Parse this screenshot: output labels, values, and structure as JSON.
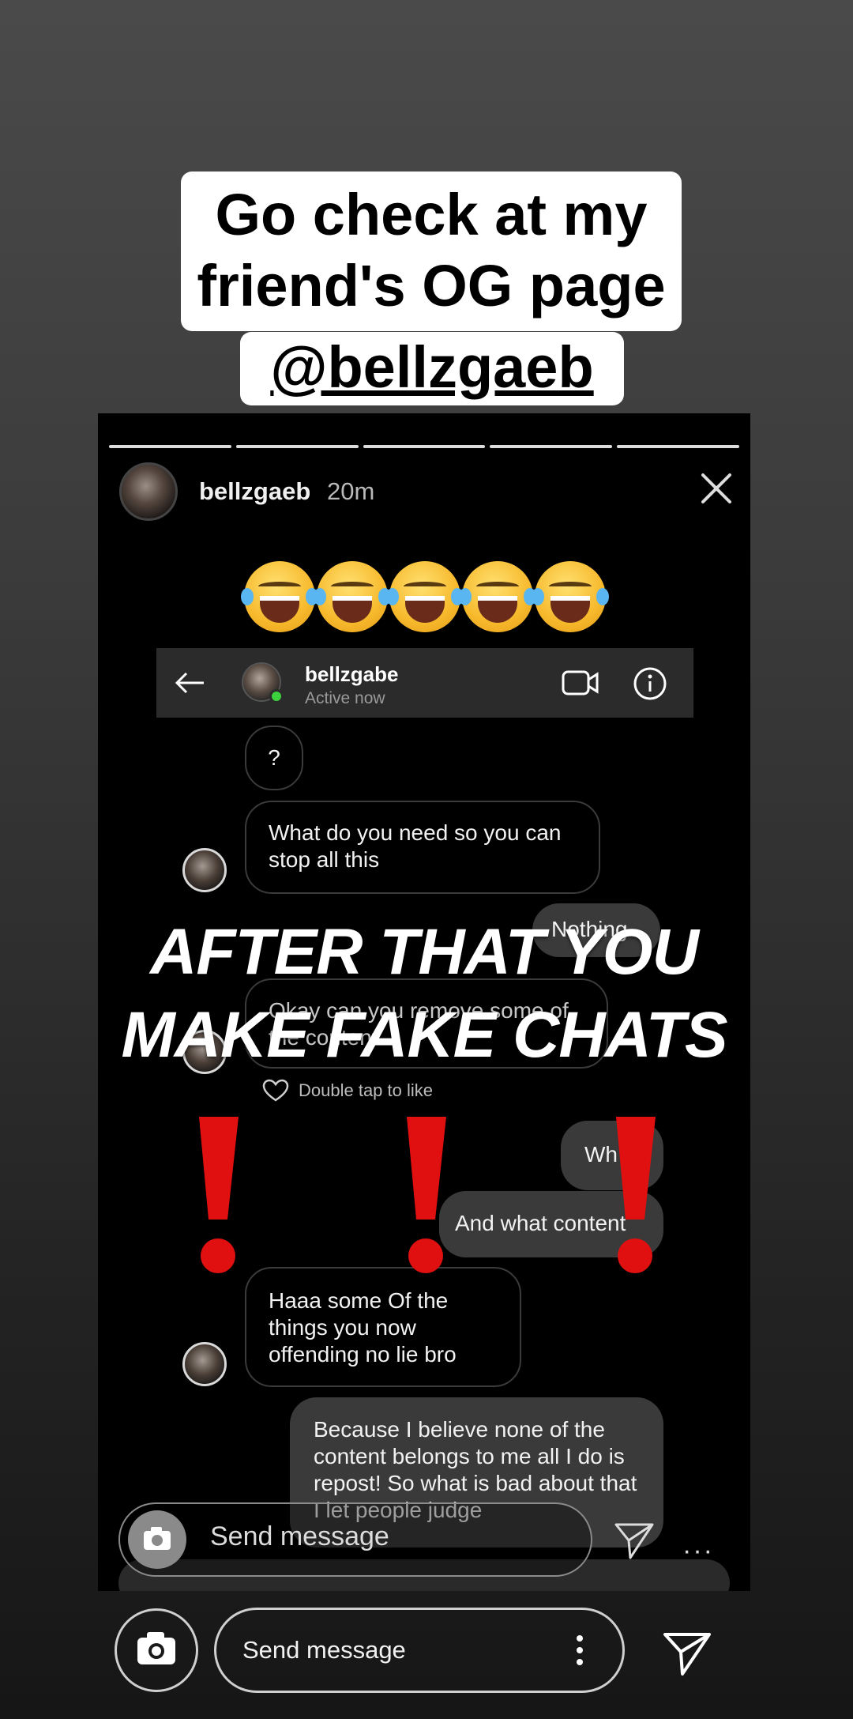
{
  "caption": {
    "line1": "Go check at my",
    "line2": "friend's OG page",
    "handle": "@bellzgaeb"
  },
  "story": {
    "username": "bellzgaeb",
    "time": "20m",
    "emoji_row": "😂😂😂😂😂",
    "dm_header": {
      "name": "bellzgabe",
      "status": "Active now"
    },
    "messages": [
      {
        "dir": "in",
        "text": "?"
      },
      {
        "dir": "in",
        "text": "What do you need so you can stop all this"
      },
      {
        "dir": "out",
        "text": "Nothing"
      },
      {
        "dir": "in",
        "text": "Okay can you remove some of the content"
      },
      {
        "dir": "out",
        "text": "Wh"
      },
      {
        "dir": "out",
        "text": "And what content"
      },
      {
        "dir": "in",
        "text": "Haaa some Of the things you now offending no lie bro"
      },
      {
        "dir": "out",
        "text": "Because I believe none of the content belongs to me all I do is repost! So what is bad about that I let people judge"
      }
    ],
    "like_hint": "Double tap to like",
    "overlay_line1": "AFTER THAT YOU",
    "overlay_line2": "MAKE FAKE CHATS",
    "inner_send_label": "Send message",
    "inner_more": "···",
    "exclamation_color": "#e01010"
  },
  "reply_bar": {
    "placeholder": "Send message"
  }
}
